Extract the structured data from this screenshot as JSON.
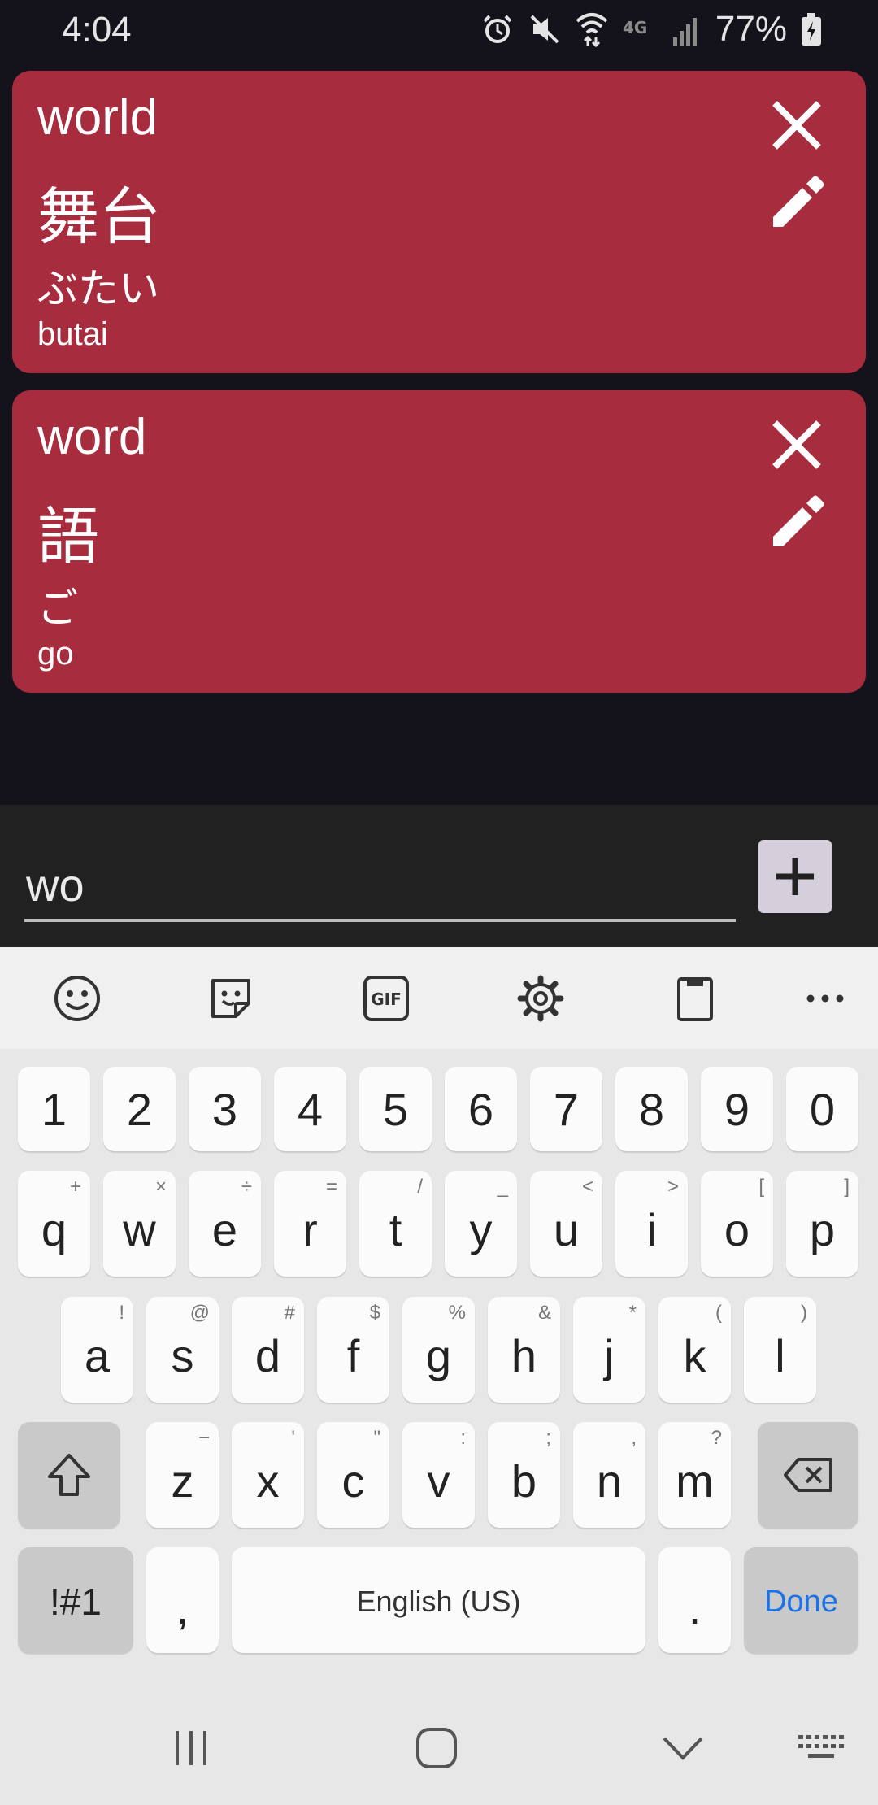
{
  "status_bar": {
    "time": "4:04",
    "battery": "77%"
  },
  "cards": [
    {
      "english": "world",
      "kanji": "舞台",
      "kana": "ぶたい",
      "romaji": "butai"
    },
    {
      "english": "word",
      "kanji": "語",
      "kana": "ご",
      "romaji": "go"
    }
  ],
  "input": {
    "value": "wo"
  },
  "keyboard": {
    "numbers": [
      "1",
      "2",
      "3",
      "4",
      "5",
      "6",
      "7",
      "8",
      "9",
      "0"
    ],
    "row1": [
      {
        "key": "q",
        "hint": "+"
      },
      {
        "key": "w",
        "hint": "×"
      },
      {
        "key": "e",
        "hint": "÷"
      },
      {
        "key": "r",
        "hint": "="
      },
      {
        "key": "t",
        "hint": "/"
      },
      {
        "key": "y",
        "hint": "_"
      },
      {
        "key": "u",
        "hint": "<"
      },
      {
        "key": "i",
        "hint": ">"
      },
      {
        "key": "o",
        "hint": "["
      },
      {
        "key": "p",
        "hint": "]"
      }
    ],
    "row2": [
      {
        "key": "a",
        "hint": "!"
      },
      {
        "key": "s",
        "hint": "@"
      },
      {
        "key": "d",
        "hint": "#"
      },
      {
        "key": "f",
        "hint": "$"
      },
      {
        "key": "g",
        "hint": "%"
      },
      {
        "key": "h",
        "hint": "&"
      },
      {
        "key": "j",
        "hint": "*"
      },
      {
        "key": "k",
        "hint": "("
      },
      {
        "key": "l",
        "hint": ")"
      }
    ],
    "row3": [
      {
        "key": "z",
        "hint": "−"
      },
      {
        "key": "x",
        "hint": "'"
      },
      {
        "key": "c",
        "hint": "\""
      },
      {
        "key": "v",
        "hint": ":"
      },
      {
        "key": "b",
        "hint": ";"
      },
      {
        "key": "n",
        "hint": ","
      },
      {
        "key": "m",
        "hint": "?"
      }
    ],
    "symbols_label": "!#1",
    "comma": ",",
    "space_label": "English (US)",
    "period": ".",
    "done_label": "Done",
    "accent_color": "#1a73e8"
  }
}
